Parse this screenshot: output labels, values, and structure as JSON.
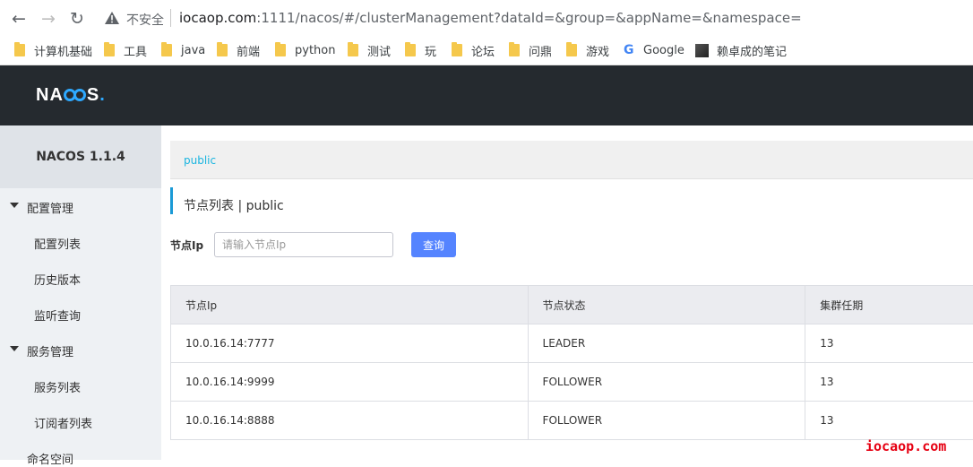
{
  "browser": {
    "security_label": "不安全",
    "url_host": "iocaop.com",
    "url_rest": ":1111/nacos/#/clusterManagement?dataId=&group=&appName=&namespace=",
    "bookmarks": [
      {
        "label": "计算机基础",
        "icon": "folder-icon"
      },
      {
        "label": "工具",
        "icon": "folder-icon"
      },
      {
        "label": "java",
        "icon": "folder-icon"
      },
      {
        "label": "前端",
        "icon": "folder-icon"
      },
      {
        "label": "python",
        "icon": "folder-icon"
      },
      {
        "label": "测试",
        "icon": "folder-icon"
      },
      {
        "label": "玩",
        "icon": "folder-icon"
      },
      {
        "label": "论坛",
        "icon": "folder-icon"
      },
      {
        "label": "问鼎",
        "icon": "folder-icon"
      },
      {
        "label": "游戏",
        "icon": "folder-icon"
      },
      {
        "label": "Google",
        "icon": "google-icon"
      },
      {
        "label": "赖卓成的笔记",
        "icon": "avatar-icon"
      }
    ]
  },
  "app": {
    "logo_text": "NACOS",
    "brand_color": "#2ea9ff",
    "header_color": "#252a2f"
  },
  "sidebar": {
    "version": "NACOS 1.1.4",
    "groups": [
      {
        "label": "配置管理",
        "items": [
          "配置列表",
          "历史版本",
          "监听查询"
        ]
      },
      {
        "label": "服务管理",
        "items": [
          "服务列表",
          "订阅者列表"
        ]
      },
      {
        "label": "命名空间",
        "items": []
      }
    ]
  },
  "main": {
    "namespace_link": "public",
    "page_title": "节点列表  |  public",
    "search": {
      "label": "节点Ip",
      "placeholder": "请输入节点Ip",
      "value": "",
      "button": "查询"
    },
    "table": {
      "headers": [
        "节点Ip",
        "节点状态",
        "集群任期"
      ],
      "rows": [
        [
          "10.0.16.14:7777",
          "LEADER",
          "13"
        ],
        [
          "10.0.16.14:9999",
          "FOLLOWER",
          "13"
        ],
        [
          "10.0.16.14:8888",
          "FOLLOWER",
          "13"
        ]
      ]
    },
    "accent_color": "#5584ff"
  },
  "watermark": "iocaop.com"
}
